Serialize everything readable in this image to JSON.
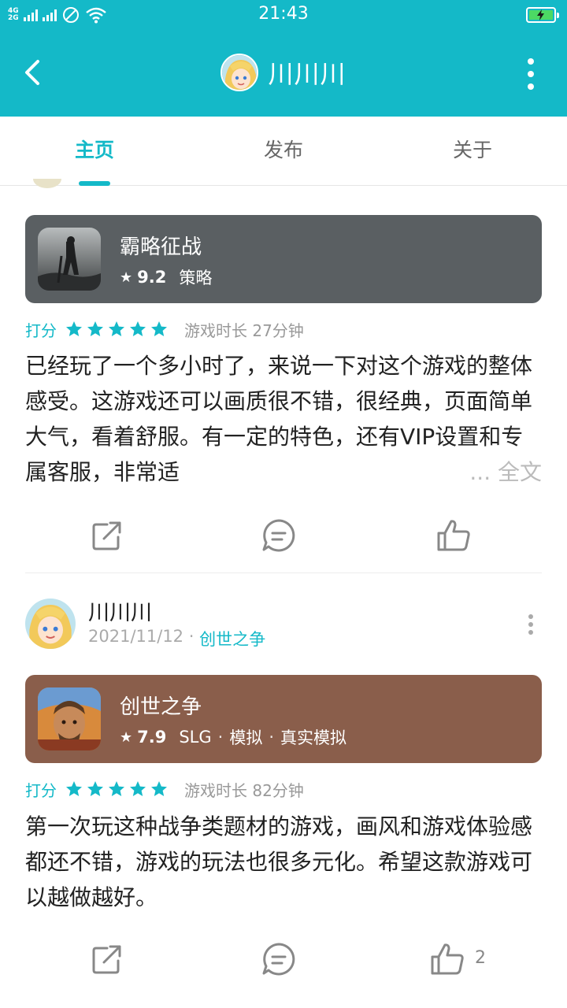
{
  "status_bar": {
    "network": [
      "4G",
      "2G"
    ],
    "time": "21:43"
  },
  "header": {
    "title": "川川川"
  },
  "tabs": [
    {
      "label": "主页",
      "active": true
    },
    {
      "label": "发布",
      "active": false
    },
    {
      "label": "关于",
      "active": false
    }
  ],
  "posts": [
    {
      "game": {
        "name": "霸略征战",
        "score": "9.2",
        "tags": [
          "策略"
        ],
        "card_color": "#5a5f62"
      },
      "rating_label": "打分",
      "stars": 5,
      "playtime": "游戏时长 27分钟",
      "text": "已经玩了一个多小时了，来说一下对这个游戏的整体感受。这游戏还可以画质很不错，很经典，页面简单大气，看着舒服。有一定的特色，还有VIP设置和专属客服，非常适",
      "more_label": "... 全文",
      "likes": ""
    },
    {
      "author": "川川川",
      "date": "2021/11/12",
      "separator": " · ",
      "game_link": "创世之争",
      "game": {
        "name": "创世之争",
        "score": "7.9",
        "tags": [
          "SLG",
          "模拟",
          "真实模拟"
        ],
        "card_color": "#8a5e4b"
      },
      "rating_label": "打分",
      "stars": 5,
      "playtime": "游戏时长 82分钟",
      "text": "第一次玩这种战争类题材的游戏，画风和游戏体验感都还不错，游戏的玩法也很多元化。希望这款游戏可以越做越好。",
      "likes": "2"
    }
  ],
  "colors": {
    "accent": "#14b9c8",
    "star": "#14b9c8"
  }
}
